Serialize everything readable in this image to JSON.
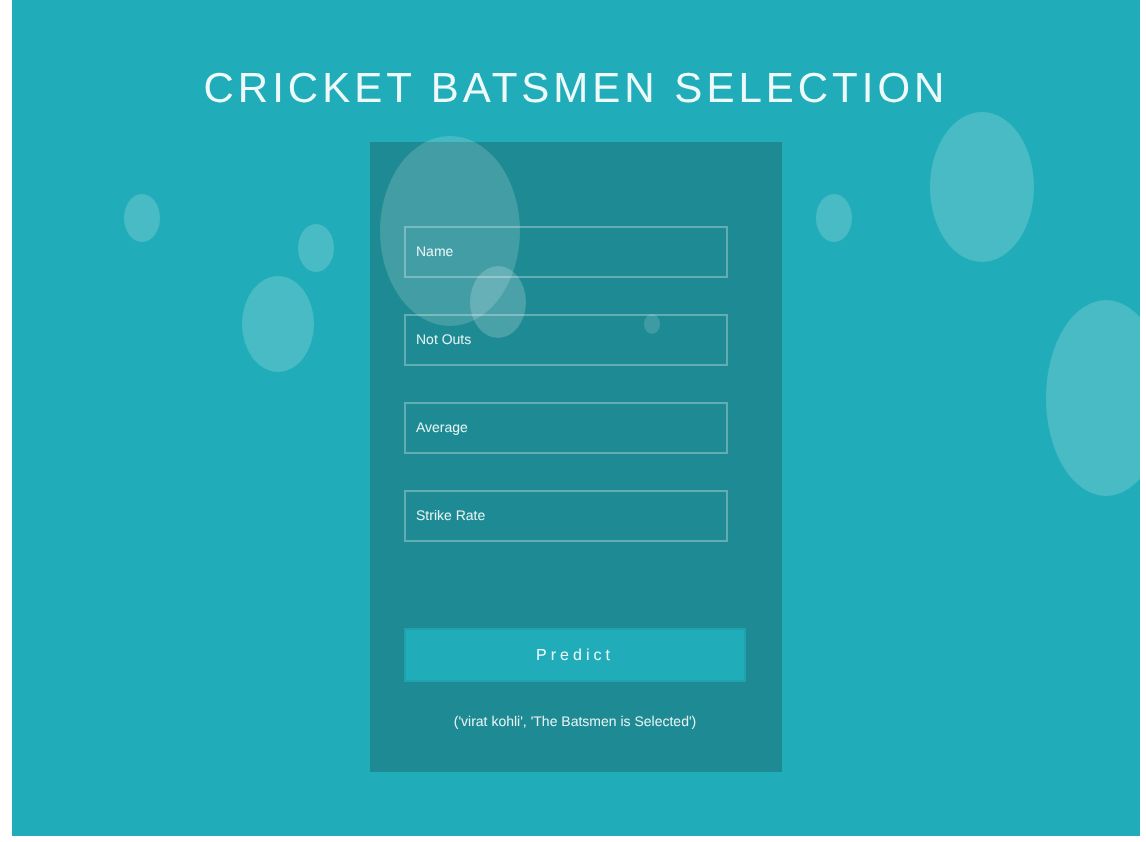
{
  "title": "CRICKET BATSMEN SELECTION",
  "form": {
    "fields": [
      {
        "placeholder": "Name"
      },
      {
        "placeholder": "Not Outs"
      },
      {
        "placeholder": "Average"
      },
      {
        "placeholder": "Strike Rate"
      }
    ],
    "button": "Predict",
    "result": "('virat kohli', 'The Batsmen is Selected')"
  }
}
